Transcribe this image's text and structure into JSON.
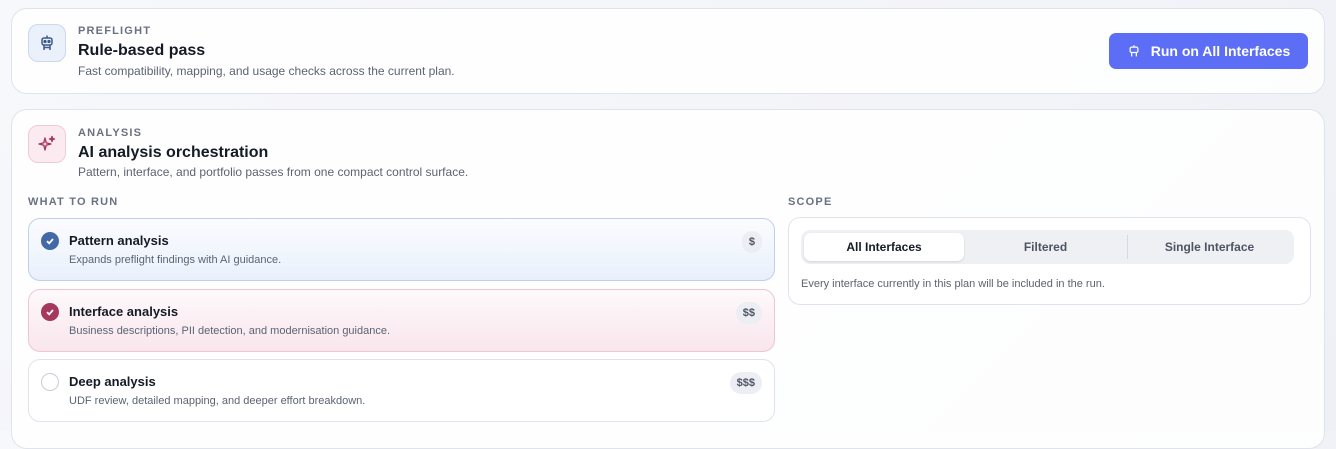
{
  "preflight": {
    "eyebrow": "PREFLIGHT",
    "title": "Rule-based pass",
    "subtitle": "Fast compatibility, mapping, and usage checks across the current plan.",
    "icon": "robot-icon",
    "run_button": "Run on All Interfaces"
  },
  "analysis": {
    "eyebrow": "ANALYSIS",
    "title": "AI analysis orchestration",
    "subtitle": "Pattern, interface, and portfolio passes from one compact control surface.",
    "icon": "sparkles-icon",
    "what_to_run_label": "WHAT TO RUN",
    "options": [
      {
        "title": "Pattern analysis",
        "desc": "Expands preflight findings with AI guidance.",
        "cost": "$",
        "checked": true
      },
      {
        "title": "Interface analysis",
        "desc": "Business descriptions, PII detection, and modernisation guidance.",
        "cost": "$$",
        "checked": true
      },
      {
        "title": "Deep analysis",
        "desc": "UDF review, detailed mapping, and deeper effort breakdown.",
        "cost": "$$$",
        "checked": false
      }
    ],
    "scope": {
      "label": "SCOPE",
      "tabs": [
        "All Interfaces",
        "Filtered",
        "Single Interface"
      ],
      "active": "All Interfaces",
      "note": "Every interface currently in this plan will be included in the run."
    }
  },
  "colors": {
    "accent": "#5b6ef5",
    "pattern_check": "#4368a8",
    "interface_check": "#a6385e"
  }
}
